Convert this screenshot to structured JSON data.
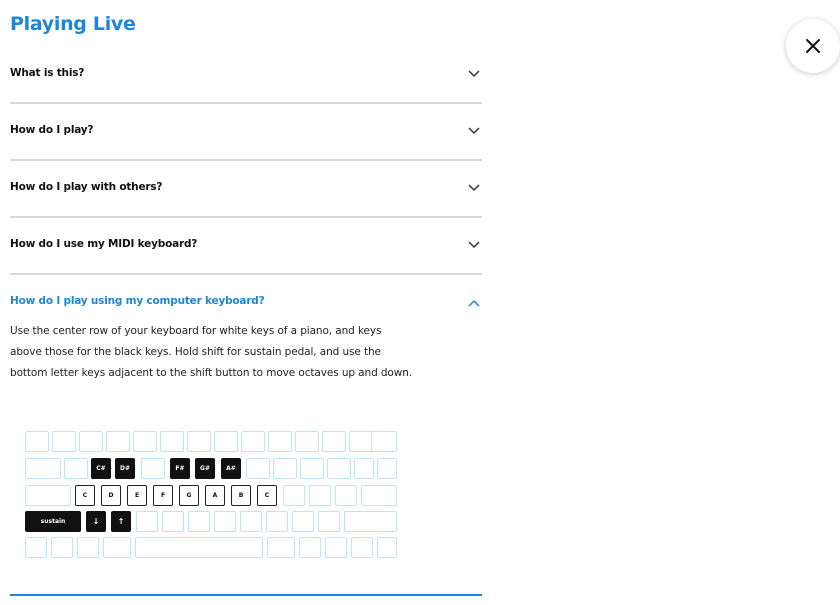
{
  "header": {
    "title": "Playing Live",
    "close_icon": "close-icon"
  },
  "faq": {
    "items": [
      {
        "question": "What is this?"
      },
      {
        "question": "How do I play?"
      },
      {
        "question": "How do I play with others?"
      },
      {
        "question": "How do I use my MIDI keyboard?"
      }
    ],
    "open_item": {
      "question": "How do I play using my computer keyboard?",
      "answer": "Use the center row of your keyboard for white keys of a piano, and keys above those for the black keys. Hold shift for sustain pedal, and use the bottom letter keys adjacent to the shift button to move octaves up and down."
    }
  },
  "keyboard": {
    "black_keys": [
      "C#",
      "D#",
      "F#",
      "G#",
      "A#"
    ],
    "white_keys": [
      "C",
      "D",
      "E",
      "F",
      "G",
      "A",
      "B",
      "C"
    ],
    "sustain_label": "sustain",
    "octave_down": "↓",
    "octave_up": "↑"
  },
  "colors": {
    "accent": "#1d86d6",
    "key_outline": "#bfe3f7"
  }
}
